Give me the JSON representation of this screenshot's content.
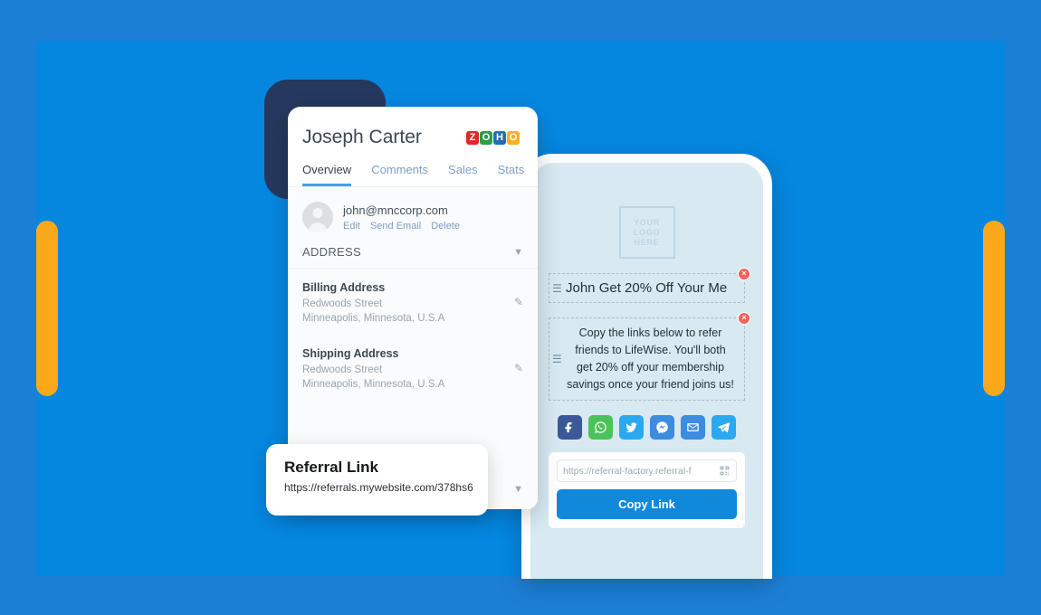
{
  "theme": {
    "outer_blue": "#1C7FD6",
    "inner_blue": "#0587E0",
    "accent_yellow": "#FBA91A",
    "navy": "#26385E",
    "phone_screen": "#D8E9F2",
    "primary_button": "#1089DB"
  },
  "crm": {
    "contact_name": "Joseph Carter",
    "brand": {
      "name": "ZOHO",
      "letters": [
        {
          "char": "Z",
          "color": "#E42527"
        },
        {
          "char": "O",
          "color": "#2C9F45"
        },
        {
          "char": "H",
          "color": "#226DB4"
        },
        {
          "char": "O",
          "color": "#F9B21D"
        }
      ]
    },
    "tabs": [
      {
        "label": "Overview",
        "active": true
      },
      {
        "label": "Comments",
        "active": false
      },
      {
        "label": "Sales",
        "active": false
      },
      {
        "label": "Stats",
        "active": false
      }
    ],
    "contact": {
      "email": "john@mnccorp.com",
      "actions": [
        "Edit",
        "Send Email",
        "Delete"
      ]
    },
    "address_section": {
      "label": "ADDRESS",
      "entries": [
        {
          "title": "Billing Address",
          "street": "Redwoods Street",
          "region": "Minneapolis, Minnesota, U.S.A"
        },
        {
          "title": "Shipping Address",
          "street": "Redwoods Street",
          "region": "Minneapolis, Minnesota, U.S.A"
        }
      ]
    }
  },
  "referral_card": {
    "title": "Referral Link",
    "url": "https://referrals.mywebsite.com/378hs6"
  },
  "phone": {
    "logo_placeholder": [
      "YOUR",
      "LOGO",
      "HERE"
    ],
    "headline": "John Get 20% Off Your Me",
    "body": "Copy the links below to refer friends to LifeWise. You'll both get 20% off your membership savings once your friend joins us!",
    "socials": [
      {
        "name": "facebook",
        "color": "#3B5998"
      },
      {
        "name": "whatsapp",
        "color": "#4AC45A"
      },
      {
        "name": "twitter",
        "color": "#2AA9F0"
      },
      {
        "name": "messenger",
        "color": "#3C8CE0"
      },
      {
        "name": "email",
        "color": "#3C8CE0"
      },
      {
        "name": "telegram",
        "color": "#2AA9F0"
      }
    ],
    "share_url": "https://referral-factory.referral-f",
    "copy_button": "Copy Link"
  }
}
